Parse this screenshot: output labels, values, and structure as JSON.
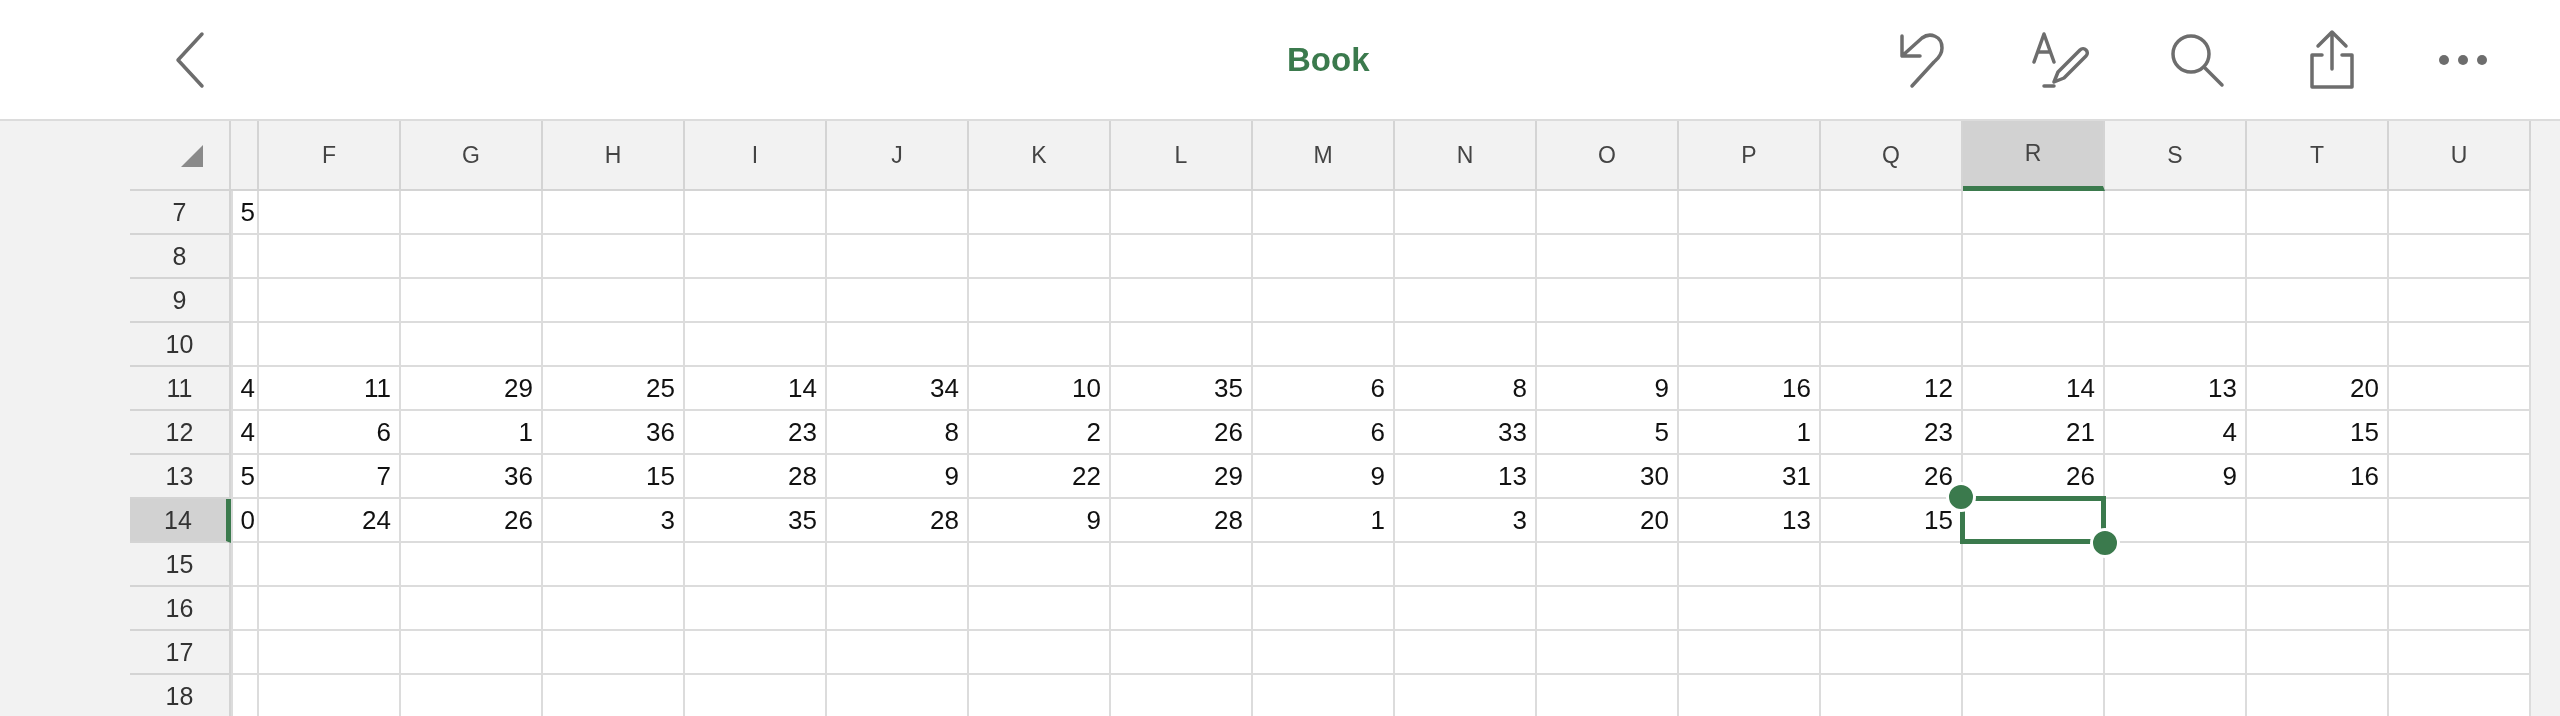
{
  "toolbar": {
    "title": "Book"
  },
  "columns": [
    {
      "kind": "partial",
      "selected": false
    },
    {
      "label": "F",
      "kind": "full",
      "selected": false
    },
    {
      "label": "G",
      "kind": "full",
      "selected": false
    },
    {
      "label": "H",
      "kind": "full",
      "selected": false
    },
    {
      "label": "I",
      "kind": "full",
      "selected": false
    },
    {
      "label": "J",
      "kind": "full",
      "selected": false
    },
    {
      "label": "K",
      "kind": "full",
      "selected": false
    },
    {
      "label": "L",
      "kind": "full",
      "selected": false
    },
    {
      "label": "M",
      "kind": "full",
      "selected": false
    },
    {
      "label": "N",
      "kind": "full",
      "selected": false
    },
    {
      "label": "O",
      "kind": "full",
      "selected": false
    },
    {
      "label": "P",
      "kind": "full",
      "selected": false
    },
    {
      "label": "Q",
      "kind": "full",
      "selected": false
    },
    {
      "label": "R",
      "kind": "full",
      "selected": true
    },
    {
      "label": "S",
      "kind": "full",
      "selected": false
    },
    {
      "label": "T",
      "kind": "full",
      "selected": false
    },
    {
      "label": "U",
      "kind": "full",
      "selected": false
    }
  ],
  "rows": [
    {
      "label": "7",
      "selected": false,
      "cells": [
        "5"
      ]
    },
    {
      "label": "8",
      "selected": false
    },
    {
      "label": "9",
      "selected": false
    },
    {
      "label": "10",
      "selected": false
    },
    {
      "label": "11",
      "selected": false,
      "cells": [
        "4",
        "11",
        "29",
        "25",
        "14",
        "34",
        "10",
        "35",
        "6",
        "8",
        "9",
        "16",
        "12",
        "14",
        "13",
        "20"
      ]
    },
    {
      "label": "12",
      "selected": false,
      "cells": [
        "4",
        "6",
        "1",
        "36",
        "23",
        "8",
        "2",
        "26",
        "6",
        "33",
        "5",
        "1",
        "23",
        "21",
        "4",
        "15"
      ]
    },
    {
      "label": "13",
      "selected": false,
      "cells": [
        "5",
        "7",
        "36",
        "15",
        "28",
        "9",
        "22",
        "29",
        "9",
        "13",
        "30",
        "31",
        "26",
        "26",
        "9",
        "16"
      ]
    },
    {
      "label": "14",
      "selected": true,
      "cells": [
        "0",
        "24",
        "26",
        "3",
        "35",
        "28",
        "9",
        "28",
        "1",
        "3",
        "20",
        "13",
        "15"
      ]
    },
    {
      "label": "15",
      "selected": false
    },
    {
      "label": "16",
      "selected": false
    },
    {
      "label": "17",
      "selected": false
    },
    {
      "label": "18",
      "selected": false
    }
  ]
}
